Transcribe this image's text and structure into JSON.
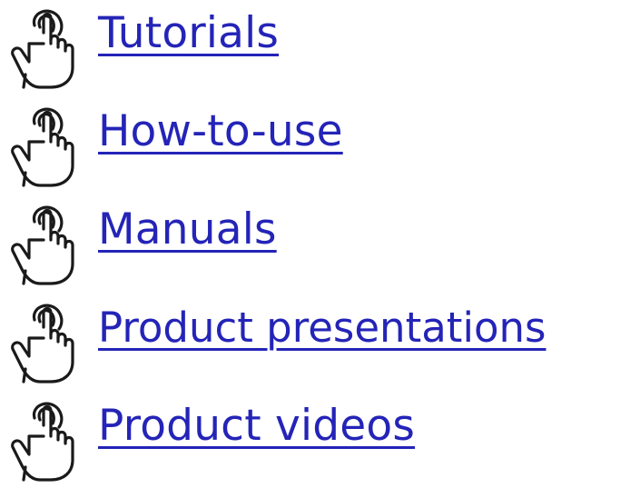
{
  "links": [
    {
      "label": "Tutorials",
      "icon": "pointing-hand-icon"
    },
    {
      "label": "How-to-use",
      "icon": "pointing-hand-icon"
    },
    {
      "label": "Manuals",
      "icon": "pointing-hand-icon"
    },
    {
      "label": "Product presentations",
      "icon": "pointing-hand-icon"
    },
    {
      "label": "Product videos",
      "icon": "pointing-hand-icon"
    }
  ],
  "colors": {
    "link": "#2424b8",
    "icon_stroke": "#1a1a1a",
    "background": "#ffffff"
  }
}
